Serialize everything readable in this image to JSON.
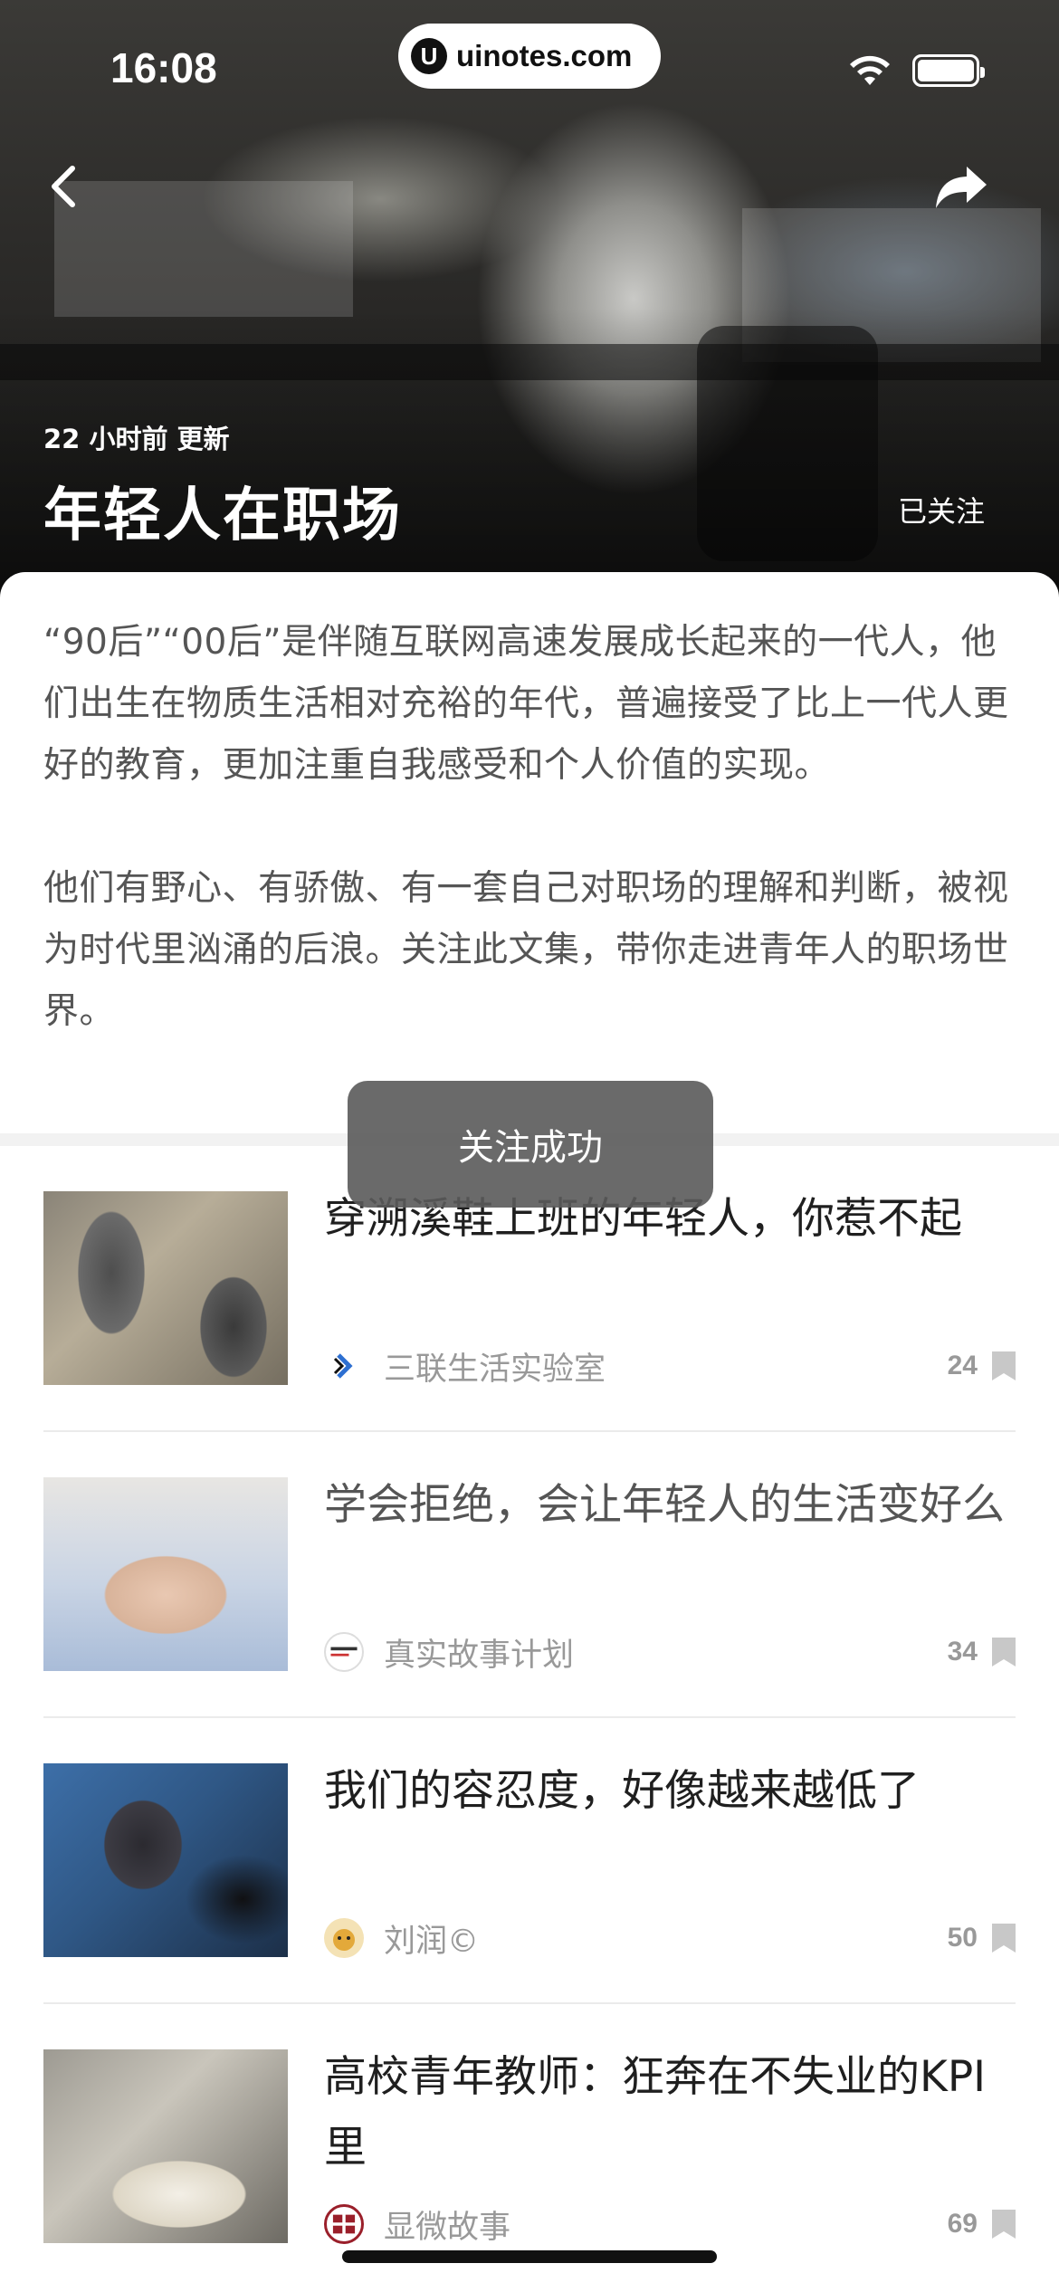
{
  "status_bar": {
    "time": "16:08",
    "url": "uinotes.com",
    "url_logo": "U"
  },
  "hero": {
    "updated": "22 小时前 更新",
    "title": "年轻人在职场",
    "follow_label": "已关注"
  },
  "description": {
    "paragraphs": [
      "“90后”“00后”是伴随互联网高速发展成长起来的一代人，他们出生在物质生活相对充裕的年代，普遍接受了比上一代人更好的教育，更加注重自我感受和个人价值的实现。",
      "他们有野心、有骄傲、有一套自己对职场的理解和判断，被视为时代里汹涌的后浪。关注此文集，带你走进青年人的职场世界。"
    ]
  },
  "toast": "关注成功",
  "articles": [
    {
      "title": "穿溯溪鞋上班的年轻人，你惹不起",
      "source": "三联生活实验室",
      "count": "24"
    },
    {
      "title": "学会拒绝，会让年轻人的生活变好么",
      "source": "真实故事计划",
      "count": "34"
    },
    {
      "title": "我们的容忍度，好像越来越低了",
      "source": "刘润©",
      "count": "50"
    },
    {
      "title": "高校青年教师：狂奔在不失业的KPI里",
      "source": "显微故事",
      "count": "69"
    }
  ],
  "colors": {
    "accent_text": "#1f1f1f",
    "muted_text": "#999999",
    "toast_bg": "#5a5a5a"
  }
}
